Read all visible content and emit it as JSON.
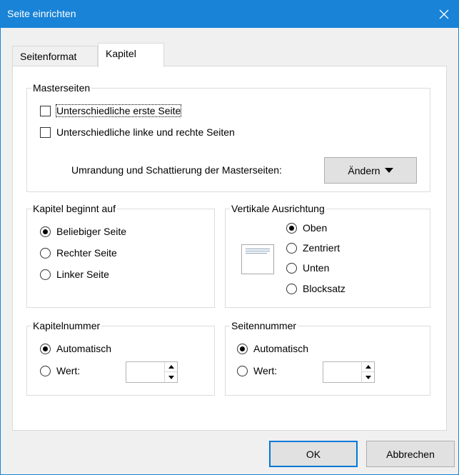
{
  "window": {
    "title": "Seite einrichten",
    "close_icon": "close-icon"
  },
  "tabs": [
    {
      "label": "Seitenformat",
      "active": false
    },
    {
      "label": "Kapitel",
      "active": true
    }
  ],
  "masterpages": {
    "legend": "Masterseiten",
    "first_page_label": "Unterschiedliche erste Seite",
    "first_page_checked": false,
    "left_right_label": "Unterschiedliche linke und rechte Seiten",
    "left_right_checked": false,
    "border_label": "Umrandung und Schattierung der Masterseiten:",
    "change_button": "Ändern"
  },
  "chapter_start": {
    "legend": "Kapitel beginnt auf",
    "options": [
      {
        "label": "Beliebiger Seite",
        "selected": true
      },
      {
        "label": "Rechter Seite",
        "selected": false
      },
      {
        "label": "Linker Seite",
        "selected": false
      }
    ]
  },
  "vertical_alignment": {
    "legend": "Vertikale Ausrichtung",
    "options": [
      {
        "label": "Oben",
        "selected": true
      },
      {
        "label": "Zentriert",
        "selected": false
      },
      {
        "label": "Unten",
        "selected": false
      },
      {
        "label": "Blocksatz",
        "selected": false
      }
    ]
  },
  "chapter_number": {
    "legend": "Kapitelnummer",
    "auto_label": "Automatisch",
    "auto_selected": true,
    "value_label": "Wert:",
    "value_selected": false,
    "value": ""
  },
  "page_number": {
    "legend": "Seitennummer",
    "auto_label": "Automatisch",
    "auto_selected": true,
    "value_label": "Wert:",
    "value_selected": false,
    "value": ""
  },
  "footer": {
    "ok": "OK",
    "cancel": "Abbrechen"
  },
  "colors": {
    "titlebar": "#1883d7",
    "default_button_border": "#0078d7",
    "panel": "#ffffff",
    "dialog_bg": "#f0f0f0"
  }
}
